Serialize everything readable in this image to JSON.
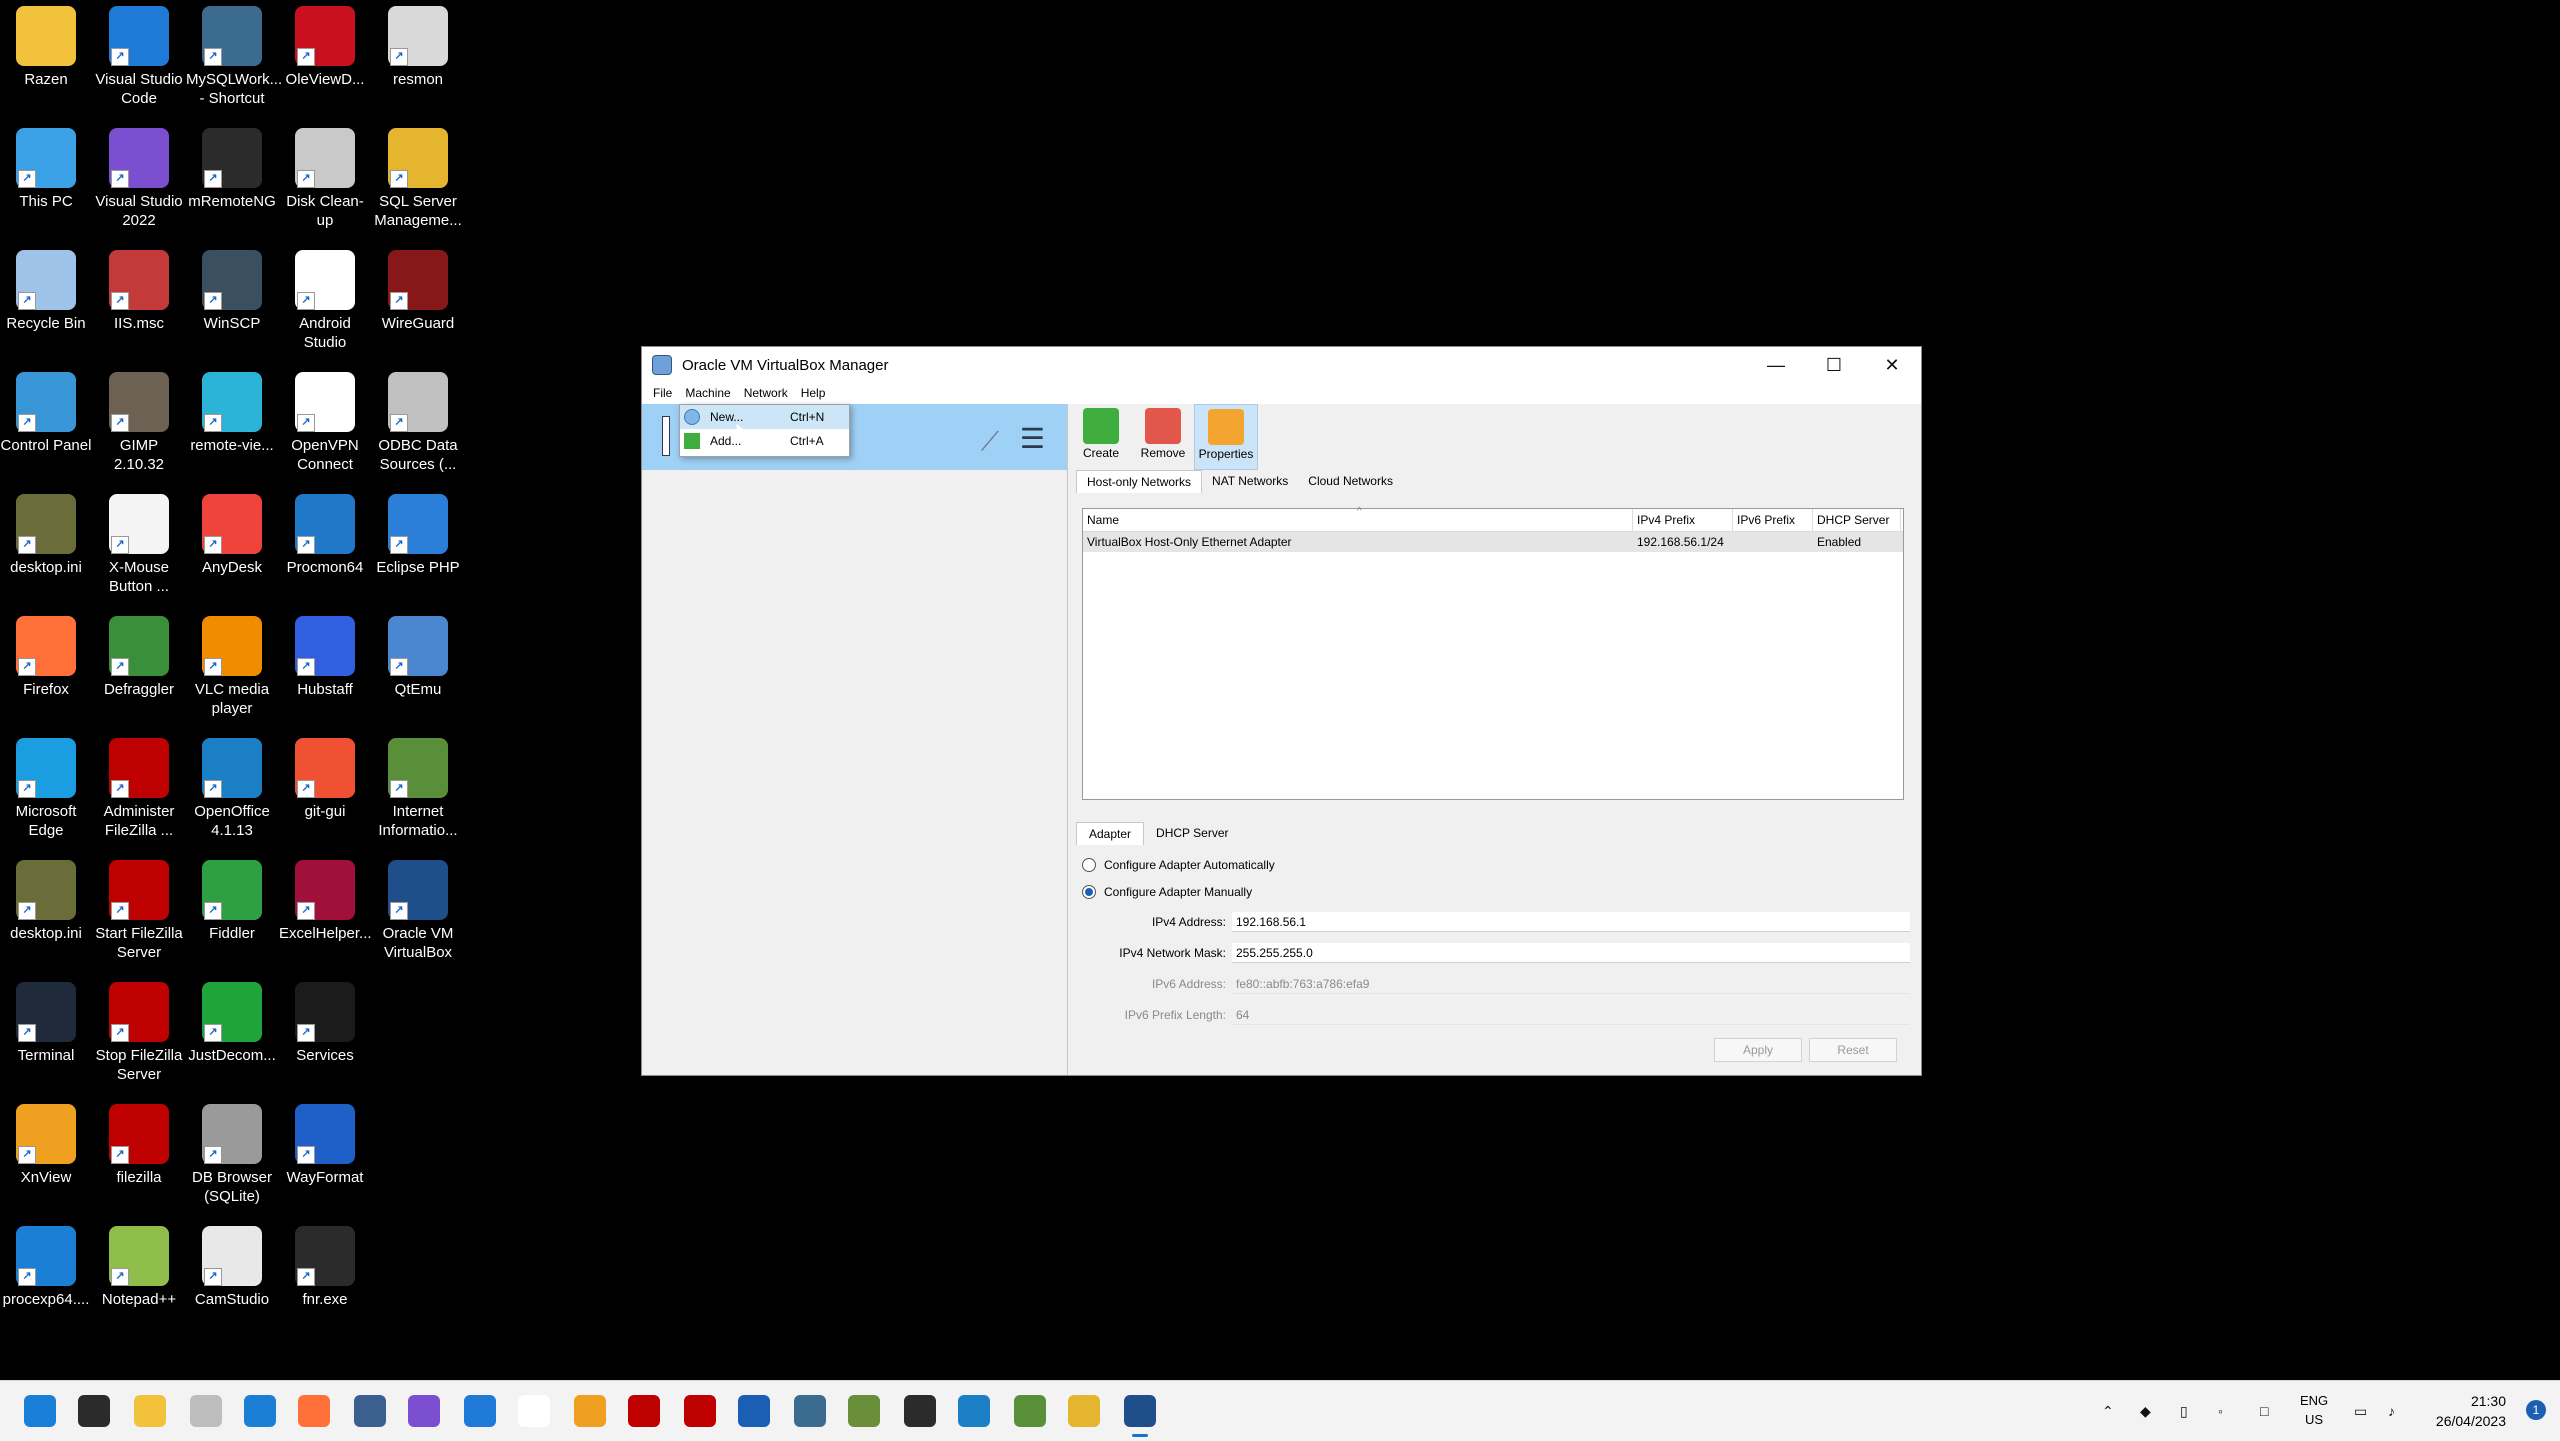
{
  "desktop": {
    "icons": [
      {
        "label": "Razen",
        "color": "#f3c23d"
      },
      {
        "label": "Visual Studio Code",
        "color": "#1e7ad6"
      },
      {
        "label": "MySQLWork... - Shortcut",
        "color": "#3b6b8f"
      },
      {
        "label": "OleViewD...",
        "color": "#c8101e"
      },
      {
        "label": "resmon",
        "color": "#d9d9d9"
      },
      {
        "label": "This PC",
        "color": "#3ba1e6"
      },
      {
        "label": "Visual Studio 2022",
        "color": "#7b4fd0"
      },
      {
        "label": "mRemoteNG",
        "color": "#2b2b2b"
      },
      {
        "label": "Disk Clean-up",
        "color": "#c9c9c9"
      },
      {
        "label": "SQL Server Manageme...",
        "color": "#e6b530"
      },
      {
        "label": "Recycle Bin",
        "color": "#9fc3e8"
      },
      {
        "label": "IIS.msc",
        "color": "#c43a3a"
      },
      {
        "label": "WinSCP",
        "color": "#3c4f5f"
      },
      {
        "label": "Android Studio",
        "color": "#ffffff"
      },
      {
        "label": "WireGuard",
        "color": "#88171a"
      },
      {
        "label": "Control Panel",
        "color": "#3996d6"
      },
      {
        "label": "GIMP 2.10.32",
        "color": "#6d6153"
      },
      {
        "label": "remote-vie...",
        "color": "#2bb3d8"
      },
      {
        "label": "OpenVPN Connect",
        "color": "#ffffff"
      },
      {
        "label": "ODBC Data Sources (...",
        "color": "#c0c0c0"
      },
      {
        "label": "desktop.ini",
        "color": "#6a6d3a"
      },
      {
        "label": "X-Mouse Button ...",
        "color": "#f4f4f4"
      },
      {
        "label": "AnyDesk",
        "color": "#ef443b"
      },
      {
        "label": "Procmon64",
        "color": "#1f78c8"
      },
      {
        "label": "Eclipse PHP",
        "color": "#2c7fd8"
      },
      {
        "label": "Firefox",
        "color": "#ff7139"
      },
      {
        "label": "Defraggler",
        "color": "#3a8f3a"
      },
      {
        "label": "VLC media player",
        "color": "#f08c00"
      },
      {
        "label": "Hubstaff",
        "color": "#3060e0"
      },
      {
        "label": "QtEmu",
        "color": "#4a87d0"
      },
      {
        "label": "Microsoft Edge",
        "color": "#1b9de2"
      },
      {
        "label": "Administer FileZilla ...",
        "color": "#bf0000"
      },
      {
        "label": "OpenOffice 4.1.13",
        "color": "#1a7fc4"
      },
      {
        "label": "git-gui",
        "color": "#f05133"
      },
      {
        "label": "Internet Informatio...",
        "color": "#5a8f3a"
      },
      {
        "label": "desktop.ini",
        "color": "#6a6d3a"
      },
      {
        "label": "Start FileZilla Server",
        "color": "#bf0000"
      },
      {
        "label": "Fiddler",
        "color": "#2ea043"
      },
      {
        "label": "ExcelHelper...",
        "color": "#a0103a"
      },
      {
        "label": "Oracle VM VirtualBox",
        "color": "#1e4f8a"
      },
      {
        "label": "Terminal",
        "color": "#1f2a3a"
      },
      {
        "label": "Stop FileZilla Server",
        "color": "#bf0000"
      },
      {
        "label": "JustDecom...",
        "color": "#1fa43a"
      },
      {
        "label": "Services",
        "color": "#1b1b1b"
      },
      {
        "label": "",
        "color": "#000000"
      },
      {
        "label": "XnView",
        "color": "#f0a020"
      },
      {
        "label": "filezilla",
        "color": "#bf0000"
      },
      {
        "label": "DB Browser (SQLite)",
        "color": "#9a9a9a"
      },
      {
        "label": "WayFormat",
        "color": "#1e5fc8"
      },
      {
        "label": "",
        "color": "#000000"
      },
      {
        "label": "procexp64....",
        "color": "#1b7fd6"
      },
      {
        "label": "Notepad++",
        "color": "#8fbf4a"
      },
      {
        "label": "CamStudio",
        "color": "#e8e8e8"
      },
      {
        "label": "fnr.exe",
        "color": "#2b2b2b"
      }
    ]
  },
  "window": {
    "title": "Oracle VM VirtualBox Manager",
    "controls": {
      "minimize": "—",
      "maximize": "☐",
      "close": "✕"
    },
    "menu": [
      "File",
      "Machine",
      "Network",
      "Help"
    ],
    "toolbar": {
      "create": "Create",
      "remove": "Remove",
      "properties": "Properties"
    },
    "tabs": [
      "Host-only Networks",
      "NAT Networks",
      "Cloud Networks"
    ],
    "table": {
      "headers": [
        "Name",
        "IPv4 Prefix",
        "IPv6 Prefix",
        "DHCP Server"
      ],
      "rows": [
        [
          "VirtualBox Host-Only Ethernet Adapter",
          "192.168.56.1/24",
          "",
          "Enabled"
        ]
      ]
    },
    "detail_tabs": [
      "Adapter",
      "DHCP Server"
    ],
    "adapter": {
      "auto_label": "Configure Adapter Automatically",
      "manual_label": "Configure Adapter Manually",
      "ipv4_label": "IPv4 Address:",
      "ipv4_value": "192.168.56.1",
      "mask_label": "IPv4 Network Mask:",
      "mask_value": "255.255.255.0",
      "ipv6_label": "IPv6 Address:",
      "ipv6_value": "fe80::abfb:763:a786:efa9",
      "ipv6_prefix_label": "IPv6 Prefix Length:",
      "ipv6_prefix_value": "64",
      "apply": "Apply",
      "reset": "Reset"
    }
  },
  "popup_menu": {
    "items": [
      {
        "label": "New...",
        "shortcut": "Ctrl+N"
      },
      {
        "label": "Add...",
        "shortcut": "Ctrl+A"
      }
    ]
  },
  "taskbar": {
    "lang": {
      "line1": "ENG",
      "line2": "US"
    },
    "clock": {
      "time": "21:30",
      "date": "26/04/2023"
    },
    "notifications": "1"
  }
}
